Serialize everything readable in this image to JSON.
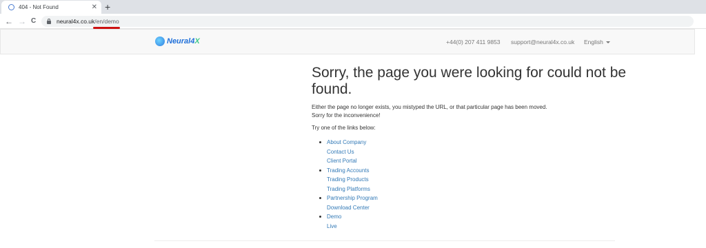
{
  "browser": {
    "tab_title": "404 - Not Found",
    "tab_close": "✕",
    "new_tab": "+",
    "back": "←",
    "forward": "→",
    "reload": "C",
    "url_host": "neural4x.co.uk",
    "url_path": "/en/demo"
  },
  "header": {
    "logo_main": "Neural4",
    "logo_x": "X",
    "phone": "+44(0) 207 411 9853",
    "email": "support@neural4x.co.uk",
    "language": "English"
  },
  "content": {
    "heading": "Sorry, the page you were looking for could not be found.",
    "line1": "Either the page no longer exists, you mistyped the URL, or that particular page has been moved.",
    "line2": "Sorry for the inconvenience!",
    "line3": "Try one of the links below:",
    "link_groups": [
      [
        "About Company",
        "Contact Us",
        "Client Portal"
      ],
      [
        "Trading Accounts",
        "Trading Products",
        "Trading Platforms"
      ],
      [
        "Partnership Program",
        "Download Center"
      ],
      [
        "Demo",
        "Live"
      ]
    ]
  },
  "colors": {
    "link": "#337ab7",
    "annotation": "#cc1111"
  }
}
